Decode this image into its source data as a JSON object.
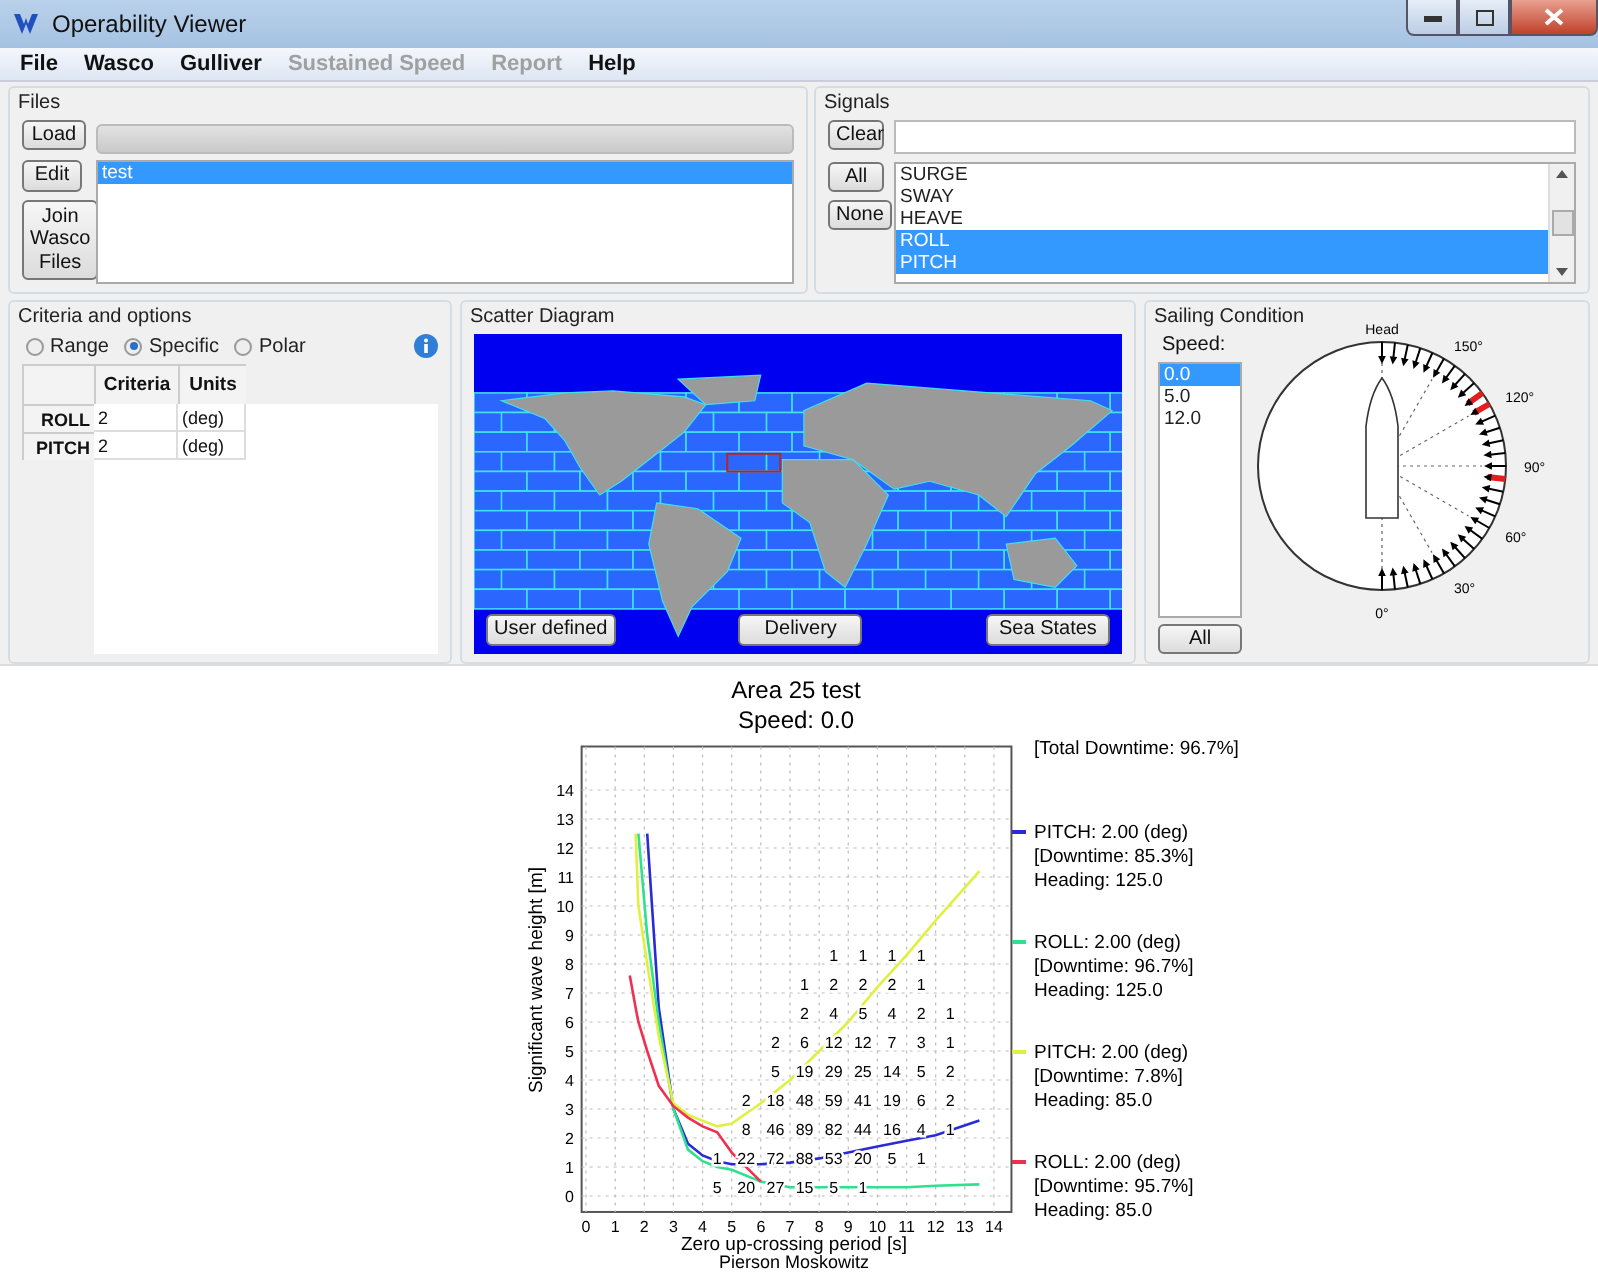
{
  "window": {
    "title": "Operability Viewer"
  },
  "menu": [
    {
      "label": "File",
      "disabled": false
    },
    {
      "label": "Wasco",
      "disabled": false
    },
    {
      "label": "Gulliver",
      "disabled": false
    },
    {
      "label": "Sustained Speed",
      "disabled": true
    },
    {
      "label": "Report",
      "disabled": true
    },
    {
      "label": "Help",
      "disabled": false
    }
  ],
  "files": {
    "title": "Files",
    "load": "Load",
    "edit": "Edit",
    "join": "Join Wasco Files",
    "items": [
      {
        "label": "test",
        "selected": true
      }
    ]
  },
  "signals": {
    "title": "Signals",
    "clear": "Clear",
    "all": "All",
    "none": "None",
    "items": [
      {
        "label": "SURGE",
        "selected": false
      },
      {
        "label": "SWAY",
        "selected": false
      },
      {
        "label": "HEAVE",
        "selected": false
      },
      {
        "label": "ROLL",
        "selected": true
      },
      {
        "label": "PITCH",
        "selected": true
      }
    ]
  },
  "criteria": {
    "title": "Criteria and options",
    "modes": [
      {
        "label": "Range",
        "selected": false
      },
      {
        "label": "Specific",
        "selected": true
      },
      {
        "label": "Polar",
        "selected": false
      }
    ],
    "columns": [
      "Criteria",
      "Units"
    ],
    "rows": [
      {
        "name": "ROLL",
        "criteria": "2",
        "units": "(deg)"
      },
      {
        "name": "PITCH",
        "criteria": "2",
        "units": "(deg)"
      }
    ]
  },
  "scatter": {
    "title": "Scatter Diagram",
    "buttons": [
      "User defined",
      "Delivery",
      "Sea States"
    ]
  },
  "sailing": {
    "title": "Sailing Condition",
    "speed_label": "Speed:",
    "speeds": [
      {
        "label": "0.0",
        "selected": true
      },
      {
        "label": "5.0",
        "selected": false
      },
      {
        "label": "12.0",
        "selected": false
      }
    ],
    "all": "All",
    "dial": {
      "top_label": "Head",
      "labels": [
        "150°",
        "120°",
        "90°",
        "60°",
        "30°",
        "0°"
      ]
    }
  },
  "plot": {
    "subtitle": "Speed: 0.0",
    "xlabel_note": "Pierson Moskowitz",
    "total": "[Total Downtime: 96.7%]",
    "legend": [
      {
        "downtime": "[Downtime: 85.3%]",
        "heading": "Heading: 125.0"
      },
      {
        "downtime": "[Downtime: 96.7%]",
        "heading": "Heading: 125.0"
      },
      {
        "downtime": "[Downtime: 7.8%]",
        "heading": "Heading: 85.0"
      },
      {
        "downtime": "[Downtime: 95.7%]",
        "heading": "Heading: 85.0"
      }
    ],
    "counts": [
      [
        {
          "kind": "blank"
        },
        {
          "kind": "blank"
        },
        {
          "kind": "blank"
        },
        {
          "kind": "blank"
        },
        {
          "kind": "count",
          "text": "1"
        },
        {
          "kind": "count",
          "text": "1"
        },
        {
          "kind": "count",
          "text": "1"
        },
        {
          "kind": "count",
          "text": "1"
        }
      ],
      [
        {
          "kind": "blank"
        },
        {
          "kind": "blank"
        },
        {
          "kind": "blank"
        },
        {
          "kind": "count",
          "text": "1"
        },
        {
          "kind": "count",
          "text": "2"
        },
        {
          "kind": "count",
          "text": "2"
        },
        {
          "kind": "count",
          "text": "2"
        },
        {
          "kind": "count",
          "text": "1"
        }
      ],
      [
        {
          "kind": "blank"
        },
        {
          "kind": "blank"
        },
        {
          "kind": "blank"
        },
        {
          "kind": "count",
          "text": "2"
        },
        {
          "kind": "count",
          "text": "4"
        },
        {
          "kind": "count",
          "text": "5"
        },
        {
          "kind": "count",
          "text": "4"
        },
        {
          "kind": "count",
          "text": "2"
        },
        {
          "kind": "count",
          "text": "1"
        }
      ],
      [
        {
          "kind": "blank"
        },
        {
          "kind": "blank"
        },
        {
          "kind": "count",
          "text": "2"
        },
        {
          "kind": "count",
          "text": "6"
        },
        {
          "kind": "count",
          "text": "12"
        },
        {
          "kind": "count",
          "text": "12"
        },
        {
          "kind": "count",
          "text": "7"
        },
        {
          "kind": "count",
          "text": "3"
        },
        {
          "kind": "count",
          "text": "1"
        }
      ],
      [
        {
          "kind": "blank"
        },
        {
          "kind": "blank"
        },
        {
          "kind": "count",
          "text": "5"
        },
        {
          "kind": "count",
          "text": "19"
        },
        {
          "kind": "count",
          "text": "29"
        },
        {
          "kind": "count",
          "text": "25"
        },
        {
          "kind": "count",
          "text": "14"
        },
        {
          "kind": "count",
          "text": "5"
        },
        {
          "kind": "count",
          "text": "2"
        }
      ],
      [
        {
          "kind": "blank"
        },
        {
          "kind": "count",
          "text": "2"
        },
        {
          "kind": "count",
          "text": "18"
        },
        {
          "kind": "count",
          "text": "48"
        },
        {
          "kind": "count",
          "text": "59"
        },
        {
          "kind": "count",
          "text": "41"
        },
        {
          "kind": "count",
          "text": "19"
        },
        {
          "kind": "count",
          "text": "6"
        },
        {
          "kind": "count",
          "text": "2"
        }
      ],
      [
        {
          "kind": "blank"
        },
        {
          "kind": "count",
          "text": "8"
        },
        {
          "kind": "count",
          "text": "46"
        },
        {
          "kind": "count",
          "text": "89"
        },
        {
          "kind": "count",
          "text": "82"
        },
        {
          "kind": "count",
          "text": "44"
        },
        {
          "kind": "count",
          "text": "16"
        },
        {
          "kind": "count",
          "text": "4"
        },
        {
          "kind": "count",
          "text": "1"
        }
      ],
      [
        {
          "kind": "count",
          "text": "1"
        },
        {
          "kind": "count",
          "text": "22"
        },
        {
          "kind": "count",
          "text": "72"
        },
        {
          "kind": "count",
          "text": "88"
        },
        {
          "kind": "count",
          "text": "53"
        },
        {
          "kind": "count",
          "text": "20"
        },
        {
          "kind": "count",
          "text": "5"
        },
        {
          "kind": "count",
          "text": "1"
        }
      ],
      [
        {
          "kind": "count",
          "text": "5"
        },
        {
          "kind": "count",
          "text": "20"
        },
        {
          "kind": "count",
          "text": "27"
        },
        {
          "kind": "count",
          "text": "15"
        },
        {
          "kind": "count",
          "text": "5"
        },
        {
          "kind": "count",
          "text": "1"
        }
      ]
    ],
    "chart_data": {
      "type": "line",
      "title": "Area 25 test",
      "xlabel": "Zero up-crossing period [s]",
      "ylabel": "Significant wave height [m]",
      "grid": true,
      "legend": "right",
      "x": [
        1.5,
        1.7,
        1.8,
        2.1,
        2.5,
        3,
        3.5,
        4,
        4.5,
        5,
        6,
        7,
        8,
        9,
        10,
        11,
        12,
        13.5
      ],
      "series": [
        {
          "name": "PITCH: 2.00 (deg)",
          "color": "#2b2bd6",
          "values": [
            null,
            null,
            null,
            12.5,
            6.5,
            3,
            1.8,
            1.4,
            1.2,
            1.1,
            1.1,
            1.15,
            1.3,
            1.5,
            1.7,
            1.9,
            2.1,
            2.6
          ]
        },
        {
          "name": "ROLL: 2.00 (deg)",
          "color": "#30e090",
          "values": [
            null,
            null,
            12.5,
            9,
            6,
            3,
            1.6,
            1.2,
            1.0,
            0.9,
            0.5,
            0.3,
            0.3,
            0.3,
            0.3,
            0.3,
            0.35,
            0.4
          ]
        },
        {
          "name": "PITCH: 2.00 (deg)",
          "color": "#e0f040",
          "values": [
            null,
            12.5,
            10,
            8,
            5.5,
            3.2,
            2.8,
            2.6,
            2.4,
            2.5,
            3.2,
            4,
            5,
            6,
            7.2,
            8.3,
            9.5,
            11.2
          ]
        },
        {
          "name": "ROLL: 2.00 (deg)",
          "color": "#f03050",
          "values": [
            7.6,
            6.5,
            6,
            5,
            3.8,
            3.1,
            2.7,
            2.4,
            2.2,
            1.5,
            0.5,
            null,
            null,
            null,
            null,
            null,
            null,
            null
          ]
        }
      ],
      "xlim": [
        -0.15,
        14.6
      ],
      "ylim": [
        -0.55,
        15.5
      ],
      "xticks": [
        0,
        1,
        2,
        3,
        4,
        5,
        6,
        7,
        8,
        9,
        10,
        11,
        12,
        13,
        14
      ],
      "yticks": [
        0,
        1,
        2,
        3,
        4,
        5,
        6,
        7,
        8,
        9,
        10,
        11,
        12,
        13,
        14
      ]
    }
  }
}
